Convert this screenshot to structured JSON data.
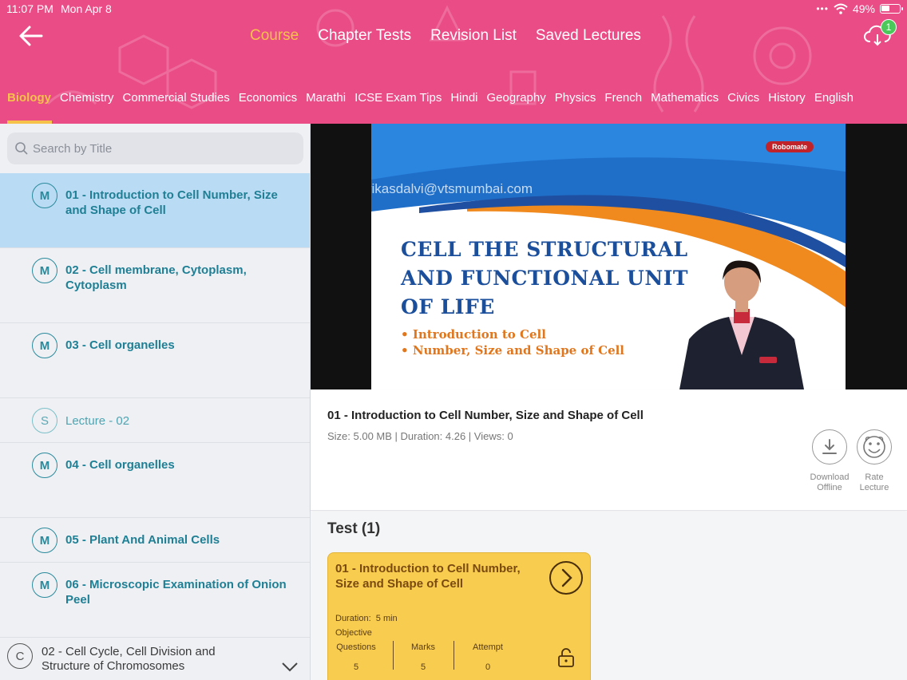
{
  "status_bar": {
    "time": "11:07 PM",
    "date": "Mon Apr 8",
    "battery": "49%",
    "battery_level": 0.49
  },
  "colors": {
    "header_bg": "#ea4c86",
    "active_tab": "#f7c24a",
    "lecture_text": "#1f7f94",
    "test_card_bg": "#f8cc4e"
  },
  "header": {
    "tabs": [
      "Course",
      "Chapter Tests",
      "Revision List",
      "Saved Lectures"
    ],
    "active_tab": "Course",
    "sync_badge": "1"
  },
  "subjects": [
    "Biology",
    "Chemistry",
    "Commercial Studies",
    "Economics",
    "Marathi",
    "ICSE Exam Tips",
    "Hindi",
    "Geography",
    "Physics",
    "French",
    "Mathematics",
    "Civics",
    "History",
    "English"
  ],
  "active_subject": "Biology",
  "search": {
    "placeholder": "Search by Title"
  },
  "lectures": [
    {
      "badge": "M",
      "title": "01 - Introduction to Cell Number, Size and Shape of Cell",
      "selected": true
    },
    {
      "badge": "M",
      "title": "02 - Cell membrane, Cytoplasm, Cytoplasm"
    },
    {
      "badge": "M",
      "title": "03 - Cell organelles"
    },
    {
      "badge": "S",
      "title": "Lecture - 02"
    },
    {
      "badge": "M",
      "title": "04 - Cell organelles"
    },
    {
      "badge": "M",
      "title": "05 - Plant And Animal Cells"
    },
    {
      "badge": "M",
      "title": "06 - Microscopic Examination of Onion Peel"
    }
  ],
  "next_chapter": {
    "badge": "C",
    "title": "02 - Cell Cycle, Cell Division and Structure of Chromosomes"
  },
  "video": {
    "logo": "Robomate",
    "watermark": "vikasdalvi@vtsmumbai.com",
    "headline_lines": [
      "CELL THE STRUCTURAL",
      "AND FUNCTIONAL UNIT",
      "OF LIFE"
    ],
    "bullets": [
      "Introduction to Cell",
      "Number, Size and Shape of Cell"
    ]
  },
  "lecture_info": {
    "title": "01 - Introduction to Cell Number, Size and Shape of Cell",
    "meta": "Size: 5.00 MB | Duration: 4.26 | Views: 0",
    "actions": [
      {
        "icon": "download-icon",
        "label_line1": "Download",
        "label_line2": "Offline"
      },
      {
        "icon": "rate-face-icon",
        "label_line1": "Rate",
        "label_line2": "Lecture"
      }
    ]
  },
  "tests": {
    "heading": "Test (1)",
    "card": {
      "title": "01 - Introduction to Cell Number, Size and Shape of Cell",
      "duration_label": "Duration:",
      "duration_value": "5 min",
      "type": "Objective",
      "questions_label": "Questions",
      "questions": "5",
      "marks_label": "Marks",
      "marks": "5",
      "attempt_label": "Attempt",
      "attempt": "0"
    }
  }
}
